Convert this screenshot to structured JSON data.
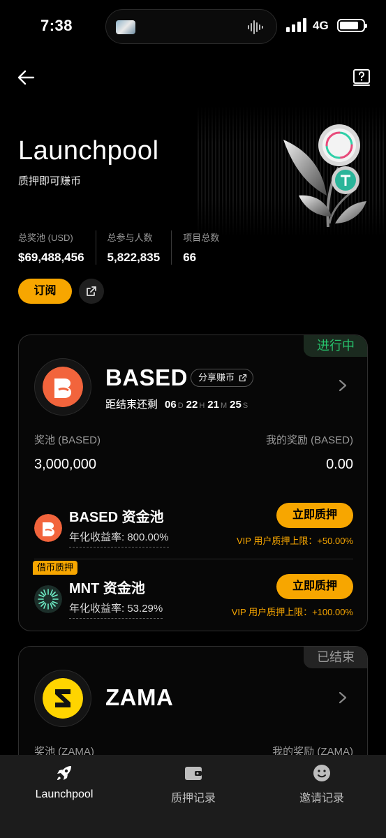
{
  "status_bar": {
    "time": "7:38",
    "network": "4G"
  },
  "hero": {
    "title": "Launchpool",
    "subtitle": "质押即可赚币"
  },
  "stats": [
    {
      "label": "总奖池 (USD)",
      "value": "$69,488,456"
    },
    {
      "label": "总参与人数",
      "value": "5,822,835"
    },
    {
      "label": "项目总数",
      "value": "66"
    }
  ],
  "actions": {
    "subscribe": "订阅"
  },
  "projects": [
    {
      "status": "进行中",
      "name": "BASED",
      "share": "分享赚币",
      "countdown": {
        "label": "距结束还剩",
        "d": "06",
        "d_unit": "D",
        "h": "22",
        "h_unit": "H",
        "m": "21",
        "m_unit": "M",
        "s": "25",
        "s_unit": "S"
      },
      "pool_label": "奖池 (BASED)",
      "pool_value": "3,000,000",
      "reward_label": "我的奖励 (BASED)",
      "reward_value": "0.00",
      "sub_pools": [
        {
          "name": "BASED 资金池",
          "apr": "年化收益率: 800.00%",
          "button": "立即质押",
          "vip": "VIP 用户质押上限：+50.00%"
        },
        {
          "tag": "借币质押",
          "name": "MNT 资金池",
          "apr": "年化收益率: 53.29%",
          "button": "立即质押",
          "vip": "VIP 用户质押上限：+100.00%"
        }
      ]
    },
    {
      "status": "已结束",
      "name": "ZAMA",
      "pool_label": "奖池 (ZAMA)",
      "reward_label": "我的奖励 (ZAMA)"
    }
  ],
  "bottom_nav": [
    {
      "label": "Launchpool",
      "icon": "rocket-icon"
    },
    {
      "label": "质押记录",
      "icon": "wallet-icon"
    },
    {
      "label": "邀请记录",
      "icon": "smiley-icon"
    }
  ],
  "colors": {
    "accent": "#f7a600",
    "live": "#27c26c",
    "based": "#f2643c",
    "zama": "#ffd400",
    "mnt": "#1c2f2a"
  }
}
